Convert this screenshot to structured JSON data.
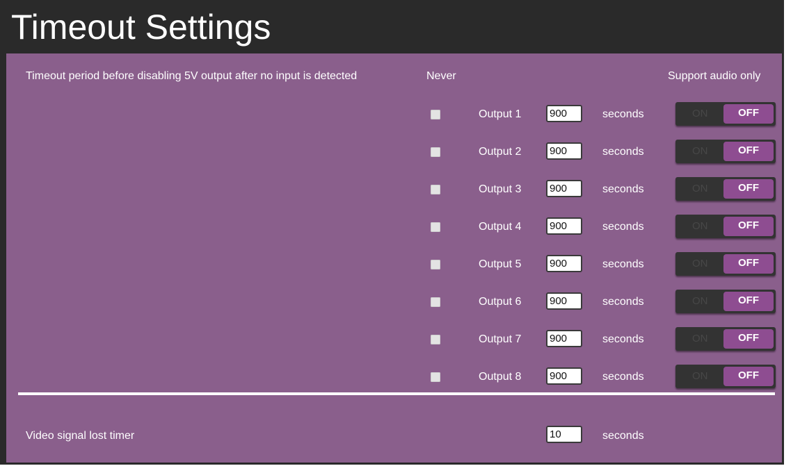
{
  "title": "Timeout Settings",
  "header": {
    "description": "Timeout period before disabling 5V output after no input is detected",
    "never": "Never",
    "support_audio": "Support audio only"
  },
  "outputs": [
    {
      "label": "Output 1",
      "value": "900",
      "unit": "seconds",
      "never": false,
      "on_label": "ON",
      "off_label": "OFF",
      "audio_only": false
    },
    {
      "label": "Output 2",
      "value": "900",
      "unit": "seconds",
      "never": false,
      "on_label": "ON",
      "off_label": "OFF",
      "audio_only": false
    },
    {
      "label": "Output 3",
      "value": "900",
      "unit": "seconds",
      "never": false,
      "on_label": "ON",
      "off_label": "OFF",
      "audio_only": false
    },
    {
      "label": "Output 4",
      "value": "900",
      "unit": "seconds",
      "never": false,
      "on_label": "ON",
      "off_label": "OFF",
      "audio_only": false
    },
    {
      "label": "Output 5",
      "value": "900",
      "unit": "seconds",
      "never": false,
      "on_label": "ON",
      "off_label": "OFF",
      "audio_only": false
    },
    {
      "label": "Output 6",
      "value": "900",
      "unit": "seconds",
      "never": false,
      "on_label": "ON",
      "off_label": "OFF",
      "audio_only": false
    },
    {
      "label": "Output 7",
      "value": "900",
      "unit": "seconds",
      "never": false,
      "on_label": "ON",
      "off_label": "OFF",
      "audio_only": false
    },
    {
      "label": "Output 8",
      "value": "900",
      "unit": "seconds",
      "never": false,
      "on_label": "ON",
      "off_label": "OFF",
      "audio_only": false
    }
  ],
  "video_signal": {
    "label": "Video signal lost timer",
    "value": "10",
    "unit": "seconds"
  },
  "colors": {
    "panel": "#8a5f8c",
    "frame": "#2a2a2a",
    "toggle_bg": "#333333",
    "toggle_active": "#8e4d91"
  }
}
